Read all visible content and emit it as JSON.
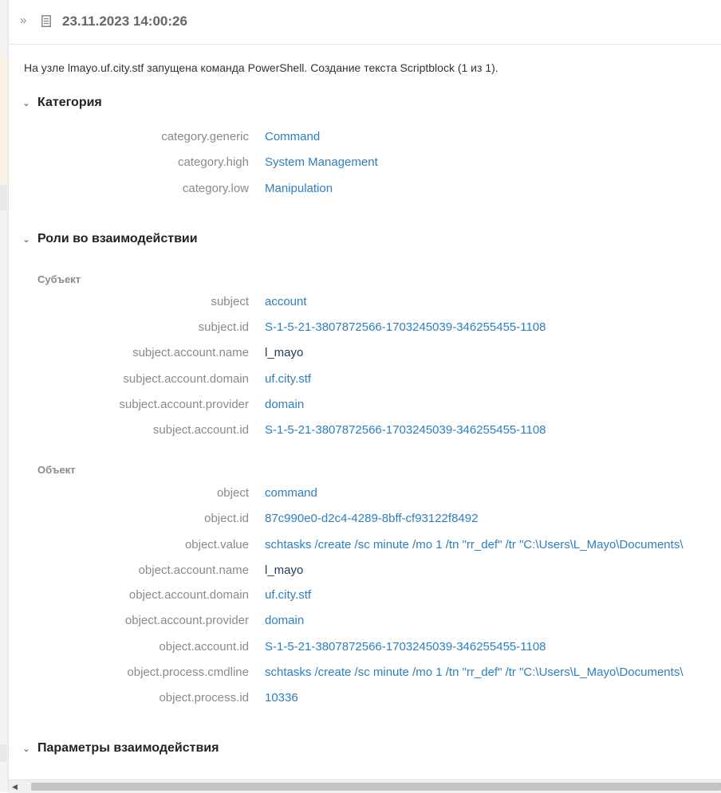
{
  "header": {
    "timestamp": "23.11.2023 14:00:26"
  },
  "description": "На узле lmayo.uf.city.stf запущена команда PowerShell. Создание текста Scriptblock (1 из 1).",
  "sections": {
    "category": {
      "title": "Категория",
      "rows": [
        {
          "key": "category.generic",
          "value": "Command"
        },
        {
          "key": "category.high",
          "value": "System Management"
        },
        {
          "key": "category.low",
          "value": "Manipulation"
        }
      ]
    },
    "roles": {
      "title": "Роли во взаимодействии",
      "subject": {
        "label": "Субъект",
        "rows": [
          {
            "key": "subject",
            "value": "account"
          },
          {
            "key": "subject.id",
            "value": "S-1-5-21-3807872566-1703245039-346255455-1108"
          },
          {
            "key": "subject.account.name",
            "value": "l_mayo"
          },
          {
            "key": "subject.account.domain",
            "value": "uf.city.stf"
          },
          {
            "key": "subject.account.provider",
            "value": "domain"
          },
          {
            "key": "subject.account.id",
            "value": "S-1-5-21-3807872566-1703245039-346255455-1108"
          }
        ]
      },
      "object": {
        "label": "Объект",
        "rows": [
          {
            "key": "object",
            "value": "command"
          },
          {
            "key": "object.id",
            "value": "87c990e0-d2c4-4289-8bff-cf93122f8492"
          },
          {
            "key": "object.value",
            "value": "schtasks /create /sc minute /mo 1 /tn \"rr_def\" /tr \"C:\\Users\\L_Mayo\\Documents\\"
          },
          {
            "key": "object.account.name",
            "value": "l_mayo"
          },
          {
            "key": "object.account.domain",
            "value": "uf.city.stf"
          },
          {
            "key": "object.account.provider",
            "value": "domain"
          },
          {
            "key": "object.account.id",
            "value": "S-1-5-21-3807872566-1703245039-346255455-1108"
          },
          {
            "key": "object.process.cmdline",
            "value": "schtasks /create /sc minute /mo 1 /tn \"rr_def\" /tr \"C:\\Users\\L_Mayo\\Documents\\"
          },
          {
            "key": "object.process.id",
            "value": "10336"
          }
        ]
      }
    },
    "params": {
      "title": "Параметры взаимодействия"
    }
  },
  "icons": {
    "expand": "double-chevron-right-icon",
    "document": "document-icon",
    "section_toggle": "chevron-down-icon"
  },
  "colors": {
    "link_value": "#2e7fc0",
    "key_text": "#8a8a8a",
    "title_text": "#666666"
  }
}
